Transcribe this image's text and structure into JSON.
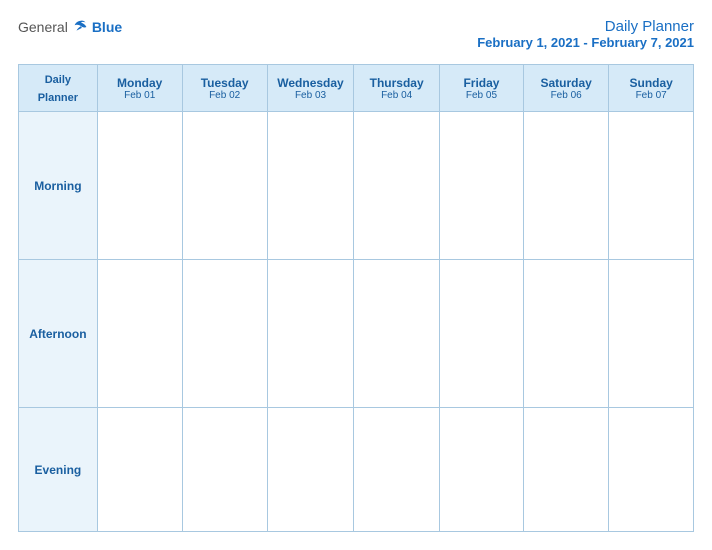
{
  "header": {
    "logo": {
      "general": "General",
      "blue": "Blue",
      "bird_symbol": "▶"
    },
    "title": {
      "main": "Daily Planner",
      "sub": "February 1, 2021 - February 7, 2021"
    }
  },
  "columns": [
    {
      "id": "label",
      "day": "Daily",
      "day2": "Planner",
      "date": ""
    },
    {
      "id": "mon",
      "day": "Monday",
      "date": "Feb 01"
    },
    {
      "id": "tue",
      "day": "Tuesday",
      "date": "Feb 02"
    },
    {
      "id": "wed",
      "day": "Wednesday",
      "date": "Feb 03"
    },
    {
      "id": "thu",
      "day": "Thursday",
      "date": "Feb 04"
    },
    {
      "id": "fri",
      "day": "Friday",
      "date": "Feb 05"
    },
    {
      "id": "sat",
      "day": "Saturday",
      "date": "Feb 06"
    },
    {
      "id": "sun",
      "day": "Sunday",
      "date": "Feb 07"
    }
  ],
  "rows": [
    {
      "id": "morning",
      "label": "Morning"
    },
    {
      "id": "afternoon",
      "label": "Afternoon"
    },
    {
      "id": "evening",
      "label": "Evening"
    }
  ]
}
